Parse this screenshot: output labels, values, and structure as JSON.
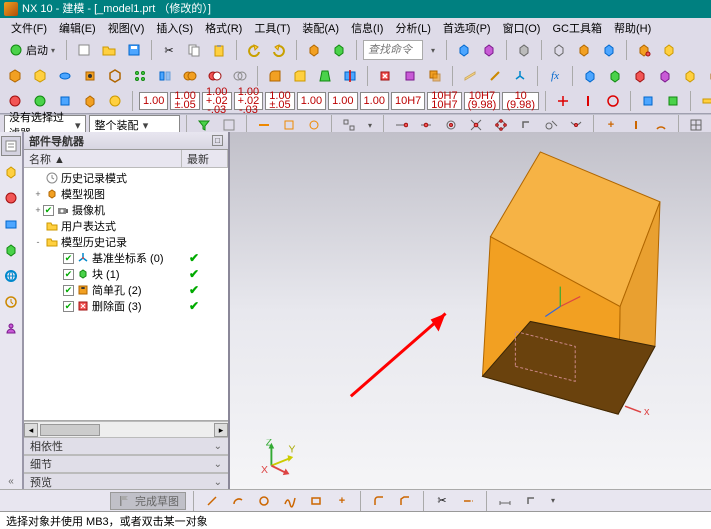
{
  "title": "NX 10 - 建模 - [_model1.prt （修改的）]",
  "menu": [
    "文件(F)",
    "编辑(E)",
    "视图(V)",
    "插入(S)",
    "格式(R)",
    "工具(T)",
    "装配(A)",
    "信息(I)",
    "分析(L)",
    "首选项(P)",
    "窗口(O)",
    "GC工具箱",
    "帮助(H)"
  ],
  "launch_label": "启动",
  "search_placeholder": "查找命令",
  "dim_row": [
    "1.00",
    "1.00\n±.05",
    "1.00\n+.02\n-.03",
    "1.00\n+.02\n-.03",
    "1.00\n±.05",
    "1.00",
    "1.00",
    "1.00",
    "10H7",
    "10H7\n10H7",
    "10H7\n(9.98)",
    "10\n(9.98)"
  ],
  "filter1": "没有选择过滤器",
  "filter2": "整个装配",
  "nav_title": "部件导航器",
  "nav_cols": [
    "名称  ▲",
    "最新"
  ],
  "tree": [
    {
      "indent": 5,
      "toggle": "",
      "check": false,
      "icon": "clock",
      "label": "历史记录模式",
      "latest": false
    },
    {
      "indent": 5,
      "toggle": "+",
      "check": false,
      "icon": "cubes",
      "label": "模型视图",
      "latest": false
    },
    {
      "indent": 5,
      "toggle": "+",
      "check": true,
      "icon": "camera",
      "label": "摄像机",
      "latest": false
    },
    {
      "indent": 5,
      "toggle": "",
      "check": false,
      "icon": "folder",
      "label": "用户表达式",
      "latest": false
    },
    {
      "indent": 5,
      "toggle": "-",
      "check": false,
      "icon": "folder",
      "label": "模型历史记录",
      "latest": false
    },
    {
      "indent": 25,
      "toggle": "",
      "check": true,
      "icon": "axes",
      "label": "基准坐标系 (0)",
      "latest": true
    },
    {
      "indent": 25,
      "toggle": "",
      "check": true,
      "icon": "cube",
      "label": "块 (1)",
      "latest": true
    },
    {
      "indent": 25,
      "toggle": "",
      "check": true,
      "icon": "hole",
      "label": "简单孔 (2)",
      "latest": true
    },
    {
      "indent": 25,
      "toggle": "",
      "check": true,
      "icon": "delf",
      "label": "删除面 (3)",
      "latest": true
    }
  ],
  "sections": [
    "相依性",
    "细节",
    "预览"
  ],
  "bottom_launch": "完成草图",
  "status": "选择对象并使用 MB3，或者双击某一对象",
  "colors": {
    "model": "#f2a022",
    "edge": "#b06600",
    "face_dark": "#a55e10"
  }
}
